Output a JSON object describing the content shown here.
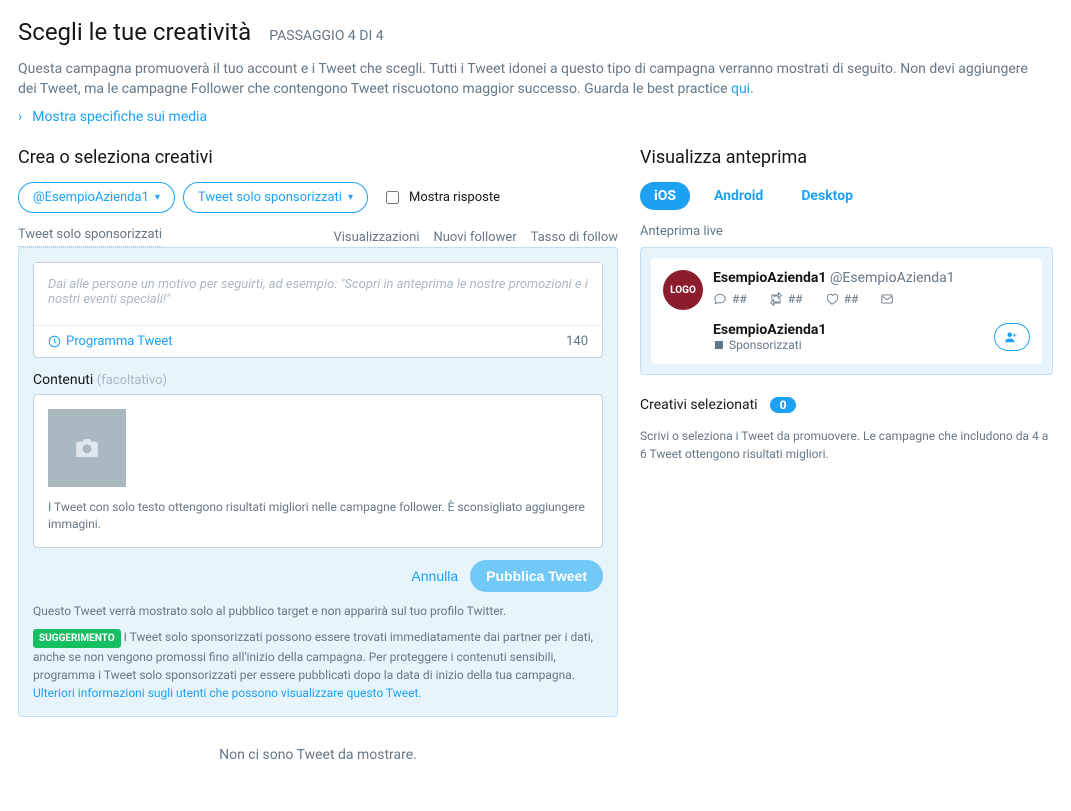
{
  "header": {
    "title": "Scegli le tue creatività",
    "step": "PASSAGGIO 4 DI 4"
  },
  "description": {
    "text": "Questa campagna promuoverà il tuo account e i Tweet che scegli. Tutti i Tweet idonei a questo tipo di campagna verranno mostrati di seguito. Non devi aggiungere dei Tweet, ma le campagne Follower che contengono Tweet riscuotono maggior successo. Guarda le best practice ",
    "link": "qui"
  },
  "media_specs": "Mostra specifiche sui media",
  "left": {
    "heading": "Crea o seleziona creativi",
    "pill_account": "@EsempioAzienda1",
    "pill_type": "Tweet solo sponsorizzati",
    "show_replies": "Mostra risposte",
    "tab_current": "Tweet solo sponsorizzati",
    "cols": {
      "views": "Visualizzazioni",
      "new_followers": "Nuovi follower",
      "follow_rate": "Tasso di follow"
    },
    "composer": {
      "placeholder": "Dai alle persone un motivo per seguirti, ad esempio: \"Scopri in anteprima le nostre promozioni e i nostri eventi speciali!\"",
      "schedule": "Programma Tweet",
      "char_count": "140",
      "contents_label": "Contenuti",
      "optional": "(facoltativo)",
      "media_hint": "I Tweet con solo testo ottengono risultati migliori nelle campagne follower. È sconsigliato aggiungere immagini.",
      "cancel": "Annulla",
      "publish": "Pubblica Tweet",
      "target_note": "Questo Tweet verrà mostrato solo al pubblico target e non apparirà sul tuo profilo Twitter.",
      "tip_badge": "SUGGERIMENTO",
      "tip_text": "I Tweet solo sponsorizzati possono essere trovati immediatamente dai partner per i dati, anche se non vengono promossi fino all'inizio della campagna. Per proteggere i contenuti sensibili, programma i Tweet solo sponsorizzati per essere pubblicati dopo la data di inizio della tua campagna. ",
      "tip_link": "Ulteriori informazioni sugli utenti che possono visualizzare questo Tweet."
    },
    "no_tweets": "Non ci sono Tweet da mostrare."
  },
  "right": {
    "heading": "Visualizza anteprima",
    "tabs": {
      "ios": "iOS",
      "android": "Android",
      "desktop": "Desktop"
    },
    "live_preview": "Anteprima live",
    "preview": {
      "logo": "LOGO",
      "name": "EsempioAzienda1",
      "handle": "@EsempioAzienda1",
      "count": "##",
      "sponsored_name": "EsempioAzienda1",
      "sponsored_tag": "Sponsorizzati"
    },
    "selected_label": "Creativi selezionati",
    "selected_count": "0",
    "hint": "Scrivi o seleziona i Tweet da promuovere. Le campagne che includono da 4 a 6 Tweet ottengono risultati migliori."
  }
}
